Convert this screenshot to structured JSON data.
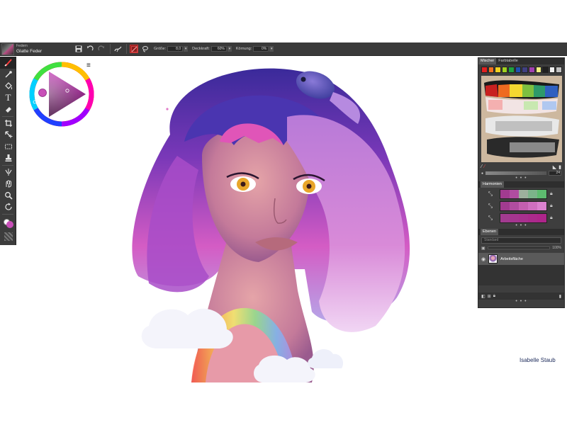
{
  "propbar": {
    "brush_category": "Federn",
    "brush_name": "Glatte Feder",
    "size_label": "Größe:",
    "size_value": "8,0",
    "opacity_label": "Deckkraft:",
    "opacity_value": "60%",
    "grain_label": "Körnung:",
    "grain_value": "0%",
    "icons": [
      "save-icon",
      "undo-icon",
      "redo-icon",
      "stroke-icon",
      "color-wheel-icon",
      "lasso-icon"
    ]
  },
  "toolbox": {
    "tools": [
      "brush-icon",
      "eyedropper-icon",
      "paint-bucket-icon",
      "text-icon",
      "eraser-icon",
      "crop-icon",
      "transform-icon",
      "selection-icon",
      "stamp-icon",
      "symmetry-icon",
      "blend-icon",
      "zoom-icon",
      "rotate-icon",
      "grid-icon"
    ],
    "text_tool_glyph": "T",
    "primary_color": "#c84fb8",
    "secondary_color": "#ffffff"
  },
  "wheel": {
    "menu_icon": "hamburger-icon",
    "selected_hue": "#c232b4"
  },
  "signature": "Isabelle Staub",
  "docker": {
    "tabs": [
      "Mischer",
      "Farbtabelle"
    ],
    "active_tab": "Mischer",
    "palette": [
      "#e02020",
      "#f07020",
      "#f0d020",
      "#a0d020",
      "#20a040",
      "#2050b0",
      "#404080",
      "#a040b0",
      "#f0f080",
      "#202020",
      "#f0f0f0",
      "#c0c0c0"
    ],
    "brush_size_value": "24",
    "harmonies": {
      "title": "Harmonien",
      "rows": [
        [
          "#a23b90",
          "#b04da0",
          "#9db09d",
          "#7cb38a",
          "#5dbb6f"
        ],
        [
          "#a23b90",
          "#b04da0",
          "#c35fb0",
          "#cf6fc0",
          "#db82cf"
        ],
        [
          "#a23b90",
          "#a5358f",
          "#a8308e",
          "#ab2a8c",
          "#ae258b"
        ]
      ]
    },
    "layers": {
      "title": "Ebenen",
      "mode": "Standard",
      "opacity": "100%",
      "layer_name": "Arbeitsfläche"
    }
  }
}
